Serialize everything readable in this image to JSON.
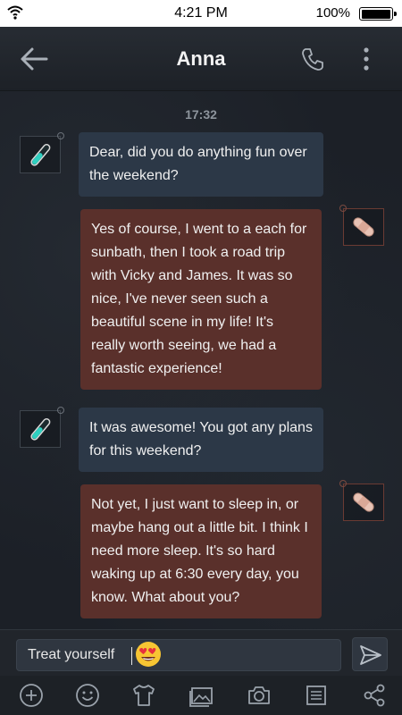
{
  "status_bar": {
    "time": "4:21 PM",
    "battery_text": "100%",
    "battery_level": 1.0
  },
  "header": {
    "title": "Anna",
    "icons": [
      "back-arrow-icon",
      "phone-icon",
      "more-vertical-icon"
    ]
  },
  "chat": {
    "timestamp": "17:32",
    "messages": [
      {
        "side": "left",
        "text": "Dear, did you do anything fun over the weekend?"
      },
      {
        "side": "right",
        "text": "Yes of course, I went to a each for sunbath, then I took a road trip with Vicky and James. It was so nice, I've never seen such a beautiful scene in my life! It's really worth seeing, we had a fantastic experience!"
      },
      {
        "side": "left",
        "text": "It was awesome! You got any plans for this weekend?"
      },
      {
        "side": "right",
        "text": "Not yet, I just want to sleep in, or maybe hang out a little bit. I think I need more sleep. It's so hard waking up at 6:30 every day, you know. What about you?"
      }
    ]
  },
  "composer": {
    "input_value": "Treat yourself",
    "emoji": "smiling-face-with-heart-eyes"
  },
  "toolbar": {
    "icons": [
      "add-icon",
      "smiley-icon",
      "tshirt-icon",
      "gallery-icon",
      "camera-icon",
      "list-icon",
      "share-icon"
    ]
  },
  "colors": {
    "left_bubble": "#2c3847",
    "right_bubble": "#5a302b",
    "background": "#1c2027"
  }
}
